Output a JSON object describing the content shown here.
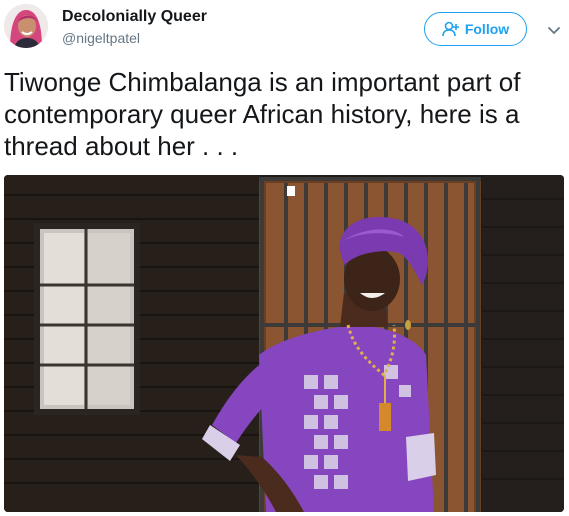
{
  "author": {
    "display_name": "Decolonially Queer",
    "handle": "@nigeltpatel",
    "avatar_icon": "profile-avatar"
  },
  "actions": {
    "follow_label": "Follow",
    "follow_icon": "add-user-icon",
    "menu_icon": "chevron-down-icon"
  },
  "tweet": {
    "text_lines": [
      "Tiwonge Chimbalanga is an important part of",
      "contemporary queer African history, here is a",
      "thread about her . . ."
    ]
  },
  "media": {
    "type": "photo"
  },
  "colors": {
    "accent": "#1da1f2",
    "text": "#14171a",
    "secondary_text": "#657786",
    "headwrap_purple": "#7a3ab0",
    "dress_purple": "#8546bf"
  }
}
